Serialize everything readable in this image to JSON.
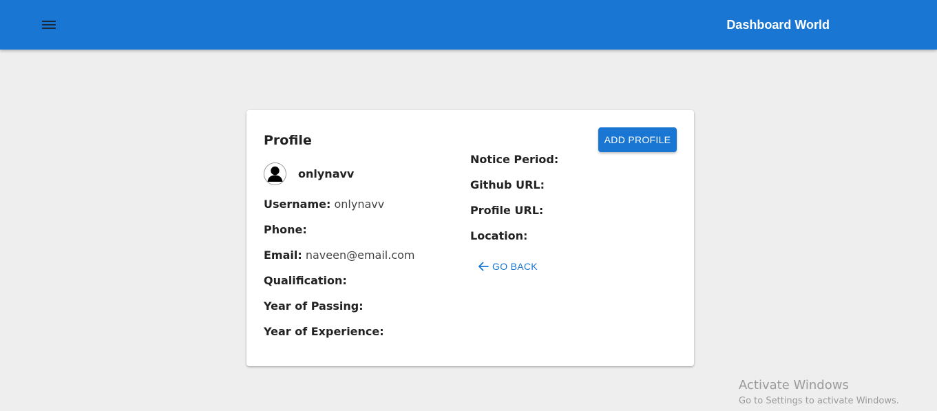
{
  "appbar": {
    "title": "Dashboard World",
    "menu_icon": "hamburger-menu-icon",
    "color": "#1976d2"
  },
  "profile": {
    "title": "Profile",
    "avatar_icon": "user-avatar-icon",
    "display_name": "onlynavv",
    "add_button_label": "ADD PROFILE",
    "back_label": "GO BACK",
    "back_icon": "arrow-left-icon",
    "left_fields": [
      {
        "label": "Username:",
        "value": "onlynavv"
      },
      {
        "label": "Phone:",
        "value": ""
      },
      {
        "label": "Email:",
        "value": "naveen@email.com"
      },
      {
        "label": "Qualification:",
        "value": ""
      },
      {
        "label": "Year of Passing:",
        "value": ""
      },
      {
        "label": "Year of Experience:",
        "value": ""
      }
    ],
    "right_fields": [
      {
        "label": "Notice Period:",
        "value": ""
      },
      {
        "label": "Github URL:",
        "value": ""
      },
      {
        "label": "Profile URL:",
        "value": ""
      },
      {
        "label": "Location:",
        "value": ""
      }
    ]
  },
  "watermark": {
    "title": "Activate Windows",
    "subtitle": "Go to Settings to activate Windows."
  }
}
